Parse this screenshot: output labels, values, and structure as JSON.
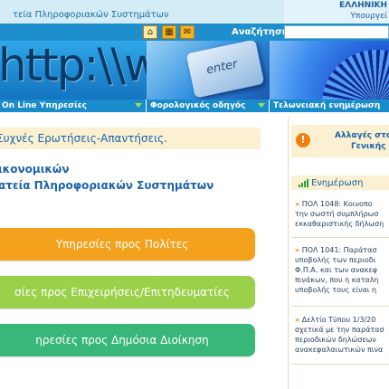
{
  "header": {
    "site_title": "τεία Πληροφοριακών Συστημάτων",
    "ministry_line_1": "ΕΛΛΗΝΙΚΗ",
    "ministry_line_2": "Υπουργεί"
  },
  "toolbar": {
    "home_icon": "home-icon",
    "sitemap_icon": "sitemap-icon",
    "contact_icon": "mail-icon",
    "search_label": "Αναζήτηση",
    "search_value": ""
  },
  "banner": {
    "http_text": "http:\\\\ww",
    "enter_text": "enter"
  },
  "nav": {
    "tab1": "On Line Υπηρεσίες",
    "tab2": "Φορολογικός οδηγός",
    "tab3": "Τελωνειακή ενημέρωση"
  },
  "main": {
    "faq": "Συχνές Ερωτήσεις-Απαντήσεις.",
    "heading_line_1": "ικονομικών",
    "heading_line_2": "ατεία Πληροφοριακών Συστημάτων",
    "services": [
      {
        "label": "Υπηρεσίες προς Πολίτες"
      },
      {
        "label": "σίες προς Επιχειρήσεις/Επιτηδευματίες"
      },
      {
        "label": "ηρεσίες προς Δημόσια Διοίκηση"
      }
    ]
  },
  "sidebar": {
    "alert_line_1": "Αλλαγές στο",
    "alert_line_2": "Γενικής Γ",
    "updates_title": "Ενημέρωση",
    "news": [
      {
        "lines": [
          "ΠΟΛ 1048: Κοινοπο",
          "την σωστή συμπλήρωσ",
          "εκκαθαριστικής δήλωση"
        ]
      },
      {
        "lines": [
          "ΠΟΛ 1041: Παράτασ",
          "υποβολής των περιοδι",
          "Φ.Π.Α. και των ανακεφ",
          "πινάκων, που η καταλη",
          "υποβολής τους είναι η"
        ]
      },
      {
        "lines": [
          "Δελτίο Τύπου 1/3/20",
          "σχετικά με την παράτασ",
          "περιοδικών δηλώσεων",
          "ανακεφαλαιωτικών πινα"
        ]
      }
    ]
  },
  "colors": {
    "primary_blue": "#1a8bcb",
    "citizens": "#f4a21d",
    "business": "#9bd04a",
    "admin": "#39b67a",
    "cream": "#fbf1d2"
  }
}
